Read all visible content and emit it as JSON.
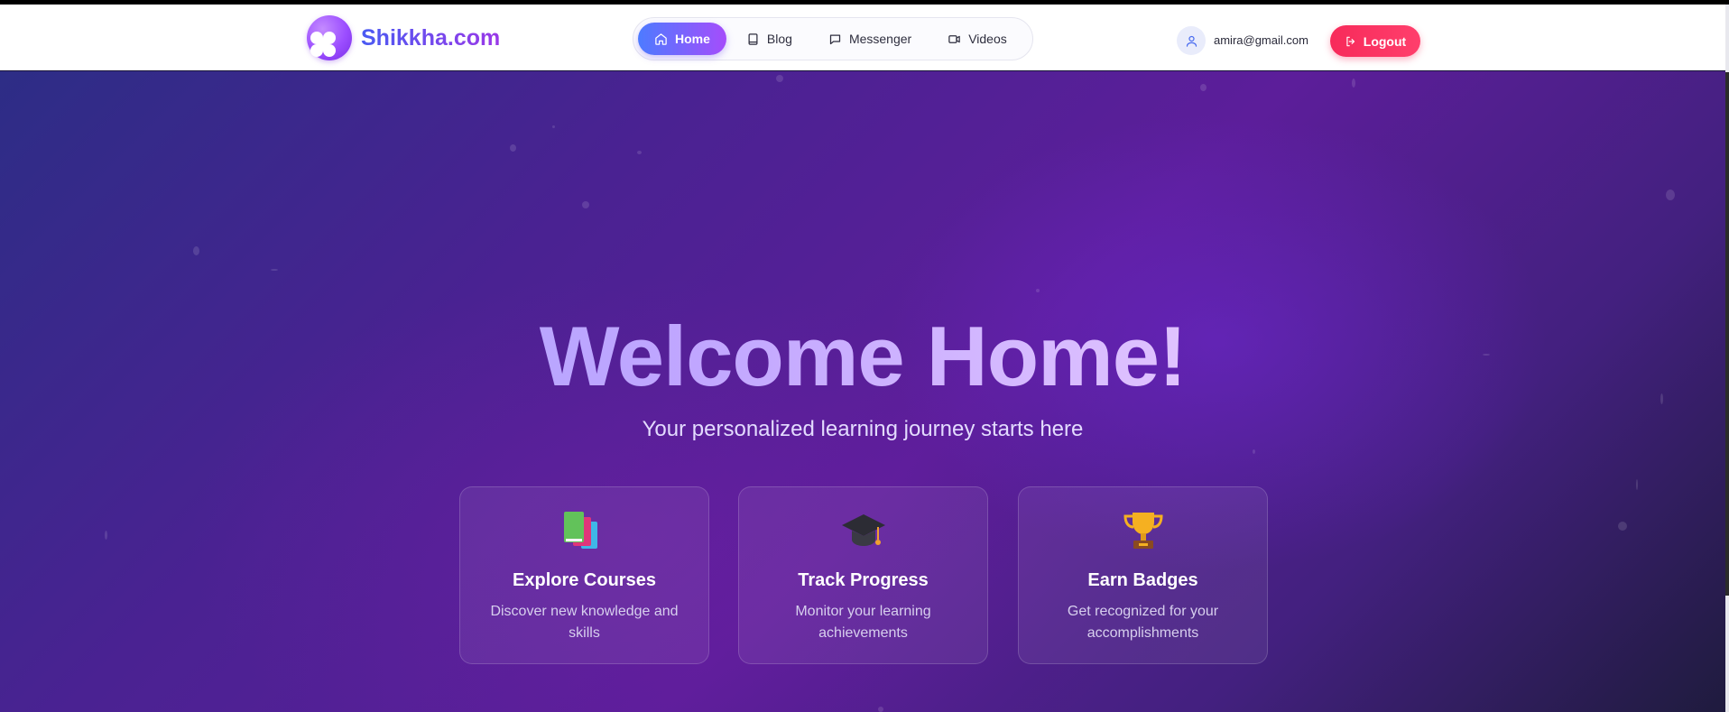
{
  "brand": {
    "name": "Shikkha.com"
  },
  "nav": {
    "items": [
      {
        "label": "Home",
        "icon": "home-icon",
        "active": true
      },
      {
        "label": "Blog",
        "icon": "book-icon",
        "active": false
      },
      {
        "label": "Messenger",
        "icon": "chat-icon",
        "active": false
      },
      {
        "label": "Videos",
        "icon": "video-icon",
        "active": false
      }
    ]
  },
  "user": {
    "email": "amira@gmail.com",
    "icon": "user-icon"
  },
  "logout": {
    "label": "Logout",
    "icon": "logout-icon"
  },
  "hero": {
    "title": "Welcome Home!",
    "subtitle": "Your personalized learning journey starts here"
  },
  "features": [
    {
      "title": "Explore Courses",
      "description": "Discover new knowledge and skills",
      "icon": "books-icon"
    },
    {
      "title": "Track Progress",
      "description": "Monitor your learning achievements",
      "icon": "graduation-cap-icon"
    },
    {
      "title": "Earn Badges",
      "description": "Get recognized for your accomplishments",
      "icon": "trophy-icon"
    }
  ],
  "colors": {
    "accent_gradient_start": "#4d7bff",
    "accent_gradient_end": "#a54dfb",
    "logout": "#f72a5a",
    "hero_bg": "#4a2292"
  }
}
